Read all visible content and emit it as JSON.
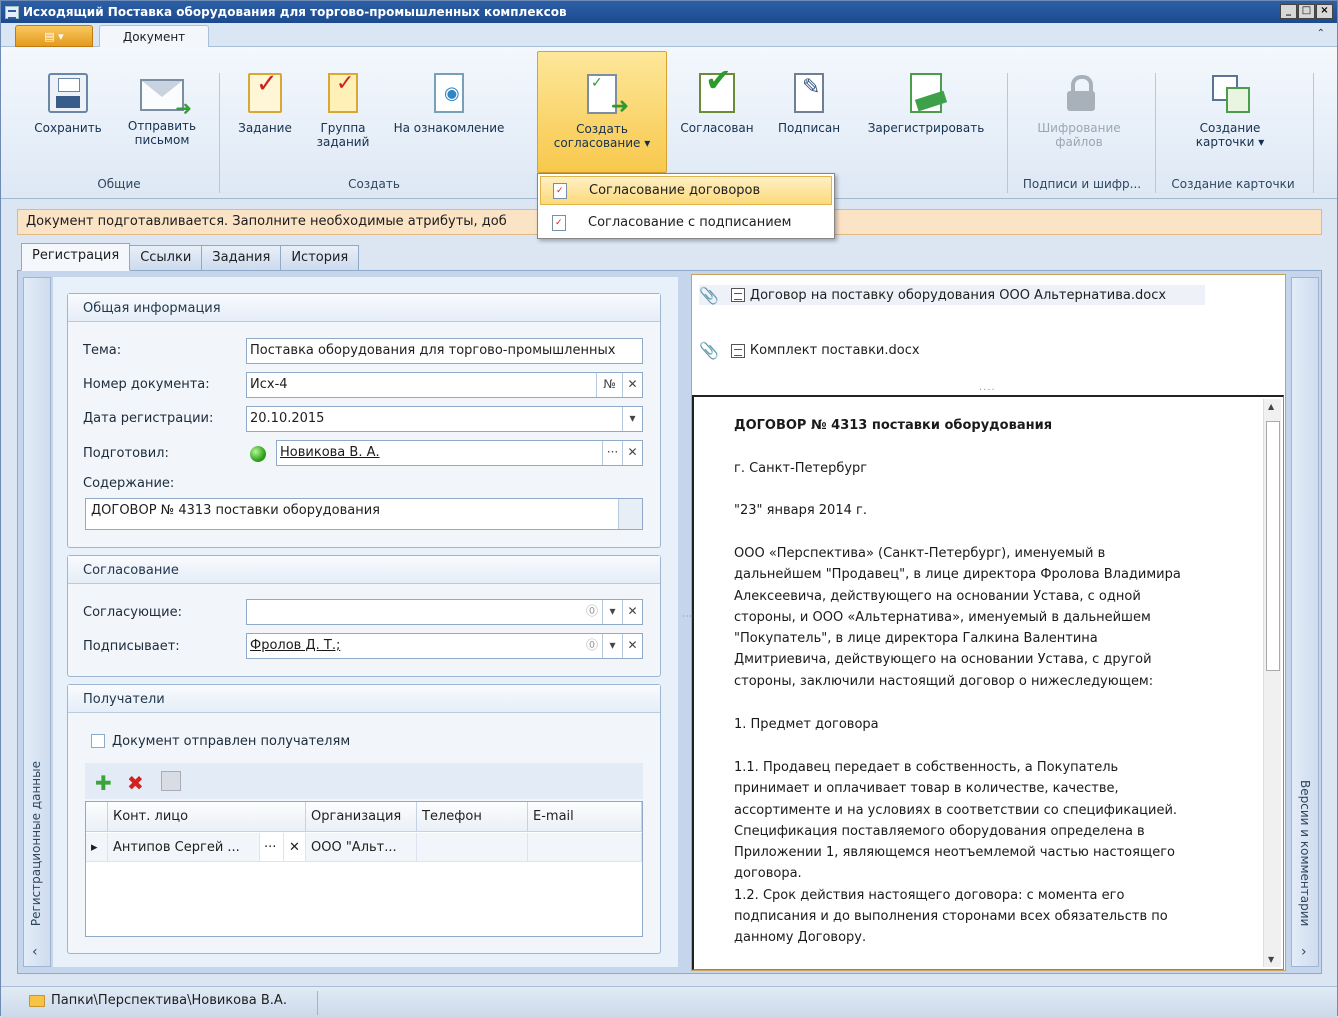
{
  "window": {
    "title": "Исходящий Поставка оборудования для торгово-промышленных комплексов",
    "controls": [
      "_",
      "□",
      "×"
    ]
  },
  "ribbon": {
    "tab_document": "Документ",
    "groups": {
      "general": "Общие",
      "create": "Создать",
      "signatures": "Подписи и шифр...",
      "card_create": "Создание карточки"
    },
    "buttons": {
      "save": "Сохранить",
      "send_line1": "Отправить",
      "send_line2": "письмом",
      "task": "Задание",
      "task_group_line1": "Группа",
      "task_group_line2": "заданий",
      "acquaint": "На ознакомление",
      "create_approval_line1": "Создать",
      "create_approval_line2": "согласование ▾",
      "agreed": "Согласован",
      "signed": "Подписан",
      "register": "Зарегистрировать",
      "encrypt_line1": "Шифрование",
      "encrypt_line2": "файлов",
      "card_line1": "Создание",
      "card_line2": "карточки ▾"
    },
    "dropdown": [
      "Согласование договоров",
      "Согласование с подписанием"
    ]
  },
  "infobar": "Документ подготавливается. Заполните необходимые атрибуты, доб",
  "tabs": [
    "Регистрация",
    "Ссылки",
    "Задания",
    "История"
  ],
  "side": {
    "left": "Регистрационные данные",
    "right": "Версии и комментарии"
  },
  "general_info": {
    "title": "Общая информация",
    "subject_label": "Тема:",
    "subject_value": "Поставка оборудования для торгово-промышленных",
    "number_label": "Номер документа:",
    "number_value": "Исх-4",
    "number_btn": "№",
    "date_label": "Дата регистрации:",
    "date_value": "20.10.2015",
    "prepared_label": "Подготовил:",
    "prepared_value": "Новикова В. А.",
    "content_label": "Содержание:",
    "content_value": "ДОГОВОР № 4313 поставки оборудования"
  },
  "approval": {
    "title": "Согласование",
    "approvers_label": "Согласующие:",
    "approvers_value": "",
    "signer_label": "Подписывает:",
    "signer_value": "Фролов Д. Т.;"
  },
  "recipients": {
    "title": "Получатели",
    "sent_checkbox": "Документ отправлен получателям",
    "columns": [
      "Конт. лицо",
      "Организация",
      "Телефон",
      "E-mail"
    ],
    "rows": [
      {
        "contact": "Антипов Сергей ...",
        "org": "ООО \"Альт...",
        "phone": "",
        "email": ""
      }
    ]
  },
  "attachments": [
    "Договор на поставку оборудования ООО Альтернатива.docx",
    "Комплект поставки.docx"
  ],
  "document": {
    "heading": "ДОГОВОР № 4313 поставки оборудования",
    "city": "г. Санкт-Петербург",
    "date": "\"23\"  января 2014 г.",
    "p1": [
      "ООО «Перспектива» (Санкт-Петербург), именуемый в",
      "дальнейшем \"Продавец\", в лице директора Фролова Владимира",
      "Алексеевича, действующего на основании Устава, с одной",
      "стороны, и ООО «Альтернатива», именуемый в дальнейшем",
      "\"Покупатель\", в лице директора  Галкина Валентина",
      "Дмитриевича, действующего на основании Устава, с другой",
      "стороны, заключили настоящий договор о нижеследующем:"
    ],
    "section1": "1. Предмет договора",
    "p2": [
      "1.1. Продавец передает в собственность, а Покупатель",
      "принимает и оплачивает товар в количестве, качестве,",
      "ассортименте и на условиях в соответствии со спецификацией.",
      "Спецификация поставляемого оборудования определена в",
      "Приложении 1, являющемся неотъемлемой частью настоящего",
      "договора.",
      "1.2. Срок действия настоящего договора: с момента его",
      "подписания и до выполнения сторонами всех обязательств по",
      "данному Договору."
    ]
  },
  "statusbar": {
    "path": "Папки\\Перспектива\\Новикова В.А."
  },
  "colors": {
    "accent": "#f8c84c",
    "titlebar": "#1b4a8e",
    "info": "#fbe3c6"
  }
}
